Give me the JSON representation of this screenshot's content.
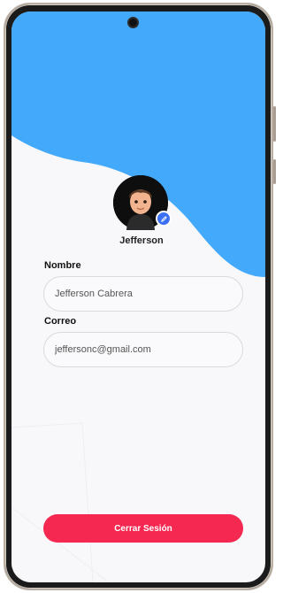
{
  "profile": {
    "display_name": "Jefferson",
    "avatar_icon": "memoji-avatar",
    "edit_icon": "pencil-icon"
  },
  "form": {
    "name_label": "Nombre",
    "name_value": "Jefferson Cabrera",
    "email_label": "Correo",
    "email_value": "jeffersonc@gmail.com"
  },
  "actions": {
    "logout_label": "Cerrar Sesión"
  },
  "colors": {
    "header_wave": "#42a9fb",
    "accent_blue": "#3b6ff5",
    "logout_red": "#f42850"
  }
}
